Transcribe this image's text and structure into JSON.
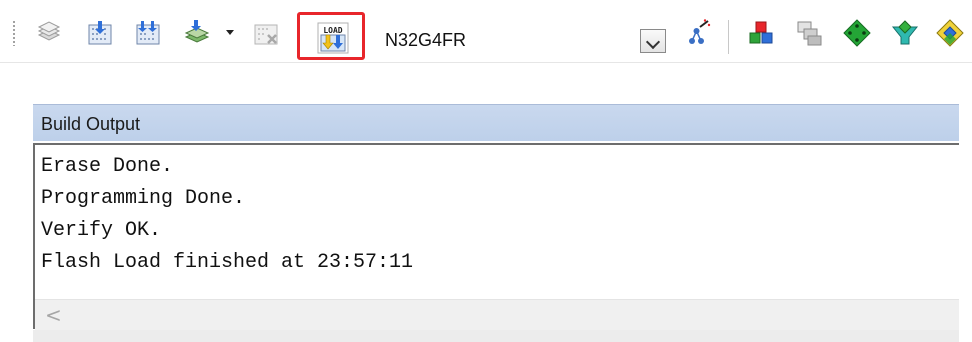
{
  "toolbar": {
    "load_label": "LOAD",
    "target_name": "N32G4FR",
    "icons": [
      "translate-icon",
      "build-icon",
      "rebuild-icon",
      "batch-build-icon",
      "stop-build-icon",
      "download-load-icon",
      "target-dropdown-icon",
      "options-wand-icon",
      "manage-components-icon",
      "copy-project-icon",
      "pack-installer-icon",
      "select-software-packs-icon",
      "manage-run-time-icon"
    ],
    "accent_color": "#e8262b"
  },
  "build_output": {
    "title": "Build Output",
    "lines": [
      "Erase Done.",
      "Programming Done.",
      "Verify OK.",
      "Flash Load finished at 23:57:11"
    ],
    "scroll_left_glyph": "<"
  }
}
